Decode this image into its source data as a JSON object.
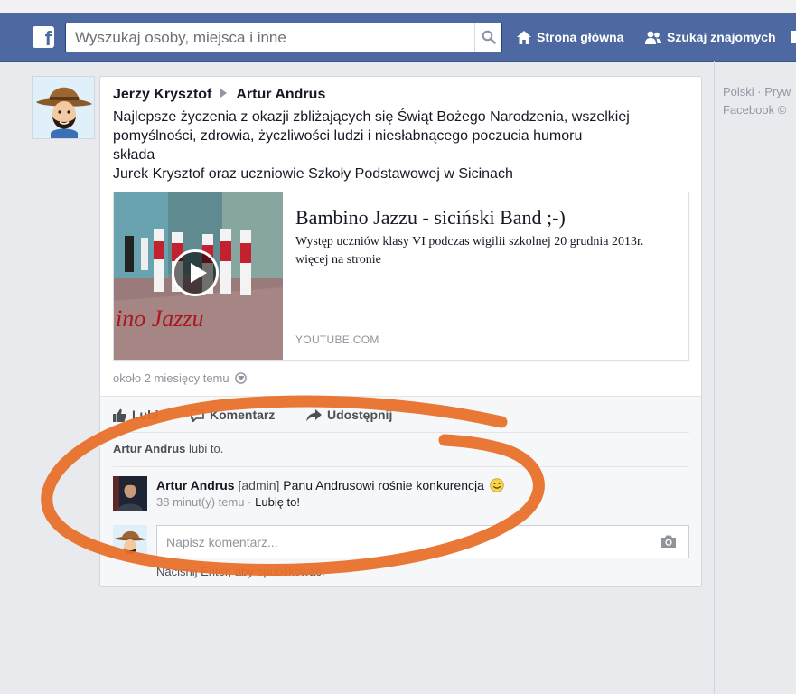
{
  "browser": {},
  "header": {
    "search_placeholder": "Wyszukaj osoby, miejsca i inne",
    "nav_home": "Strona główna",
    "nav_find_friends": "Szukaj znajomych",
    "brand_color": "#4e69a2"
  },
  "post": {
    "author": "Jerzy Krysztof",
    "target": "Artur Andrus",
    "text_lines": [
      "Najlepsze życzenia z okazji zbliżających się Świąt Bożego Narodzenia, wszelkiej",
      "pomyślności, zdrowia, życzliwości ludzi i niesłabnącego poczucia humoru",
      "składa",
      "Jurek Krysztof oraz uczniowie Szkoły Podstawowej w Sicinach"
    ],
    "link": {
      "title": "Bambino Jazzu - siciński Band ;-)",
      "description": "Występ uczniów klasy VI podczas wigilii szkolnej 20 grudnia 2013r. więcej na stronie",
      "domain": "YOUTUBE.COM",
      "thumb_overlay_text": "ino Jazzu"
    },
    "timestamp": "około 2 miesięcy temu",
    "actions": {
      "like": "Lubię to!",
      "like_visible": "Lubi",
      "comment": "Komentarz",
      "share": "Udostępnij"
    },
    "likes": {
      "name": "Artur Andrus",
      "suffix": " lubi to."
    },
    "comment": {
      "author": "Artur Andrus",
      "tag": "[admin]",
      "text": "Panu Andrusowi rośnie konkurencja",
      "time": "38 minut(y) temu",
      "separator": "·",
      "like": "Lubię to!"
    },
    "write_comment": {
      "placeholder": "Napisz komentarz...",
      "hint": "Naciśnij Enter, aby opublikować."
    }
  },
  "sidebar": {
    "footer_line1": "Polski · Pryw",
    "footer_line2": "Facebook ©"
  },
  "colors": {
    "annotation": "#e8702a",
    "link_gray": "#90949c"
  }
}
